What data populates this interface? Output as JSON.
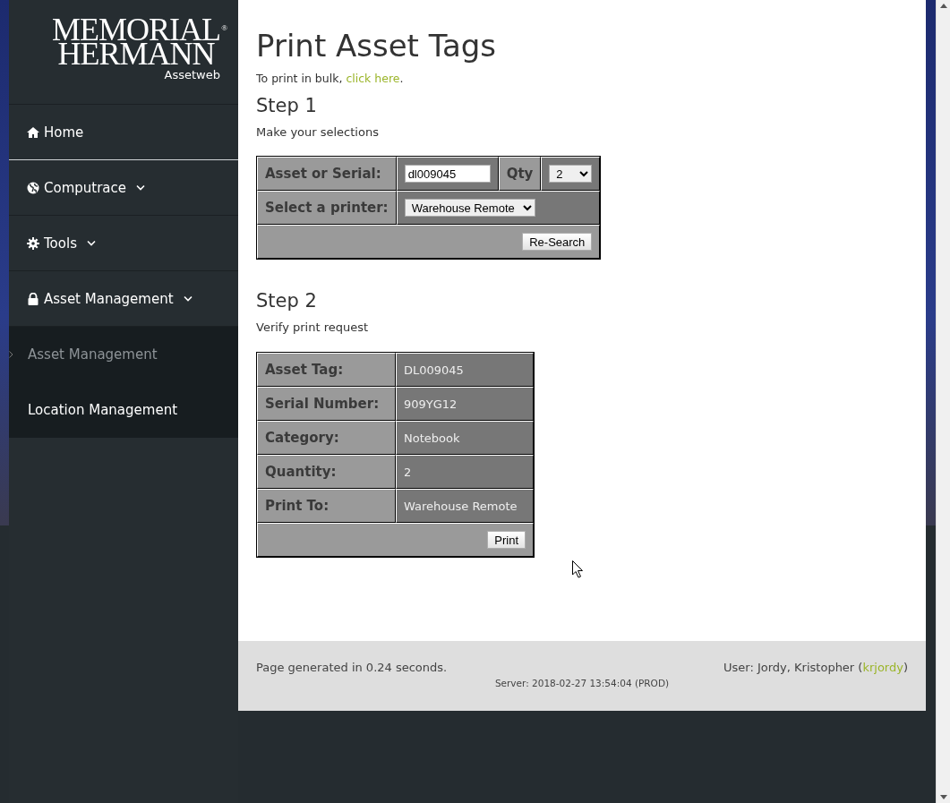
{
  "logo": {
    "line1": "MEMORIAL",
    "line2": "HERMANN",
    "registered": "®",
    "app": "Assetweb"
  },
  "nav": [
    {
      "label": "Home",
      "kind": "link",
      "selected": true
    },
    {
      "label": "Computrace",
      "kind": "dropdown",
      "selected": false
    },
    {
      "label": "Tools",
      "kind": "dropdown",
      "selected": false
    },
    {
      "label": "Asset Management",
      "kind": "dropdown",
      "selected": false,
      "children": [
        {
          "label": "Asset Management",
          "selected": true
        },
        {
          "label": "Location Management",
          "selected": false
        }
      ]
    }
  ],
  "page": {
    "title": "Print Asset Tags",
    "intro": {
      "text": "To print in bulk, ",
      "link": "click here",
      "end": "."
    },
    "step1": {
      "heading": "Step 1",
      "subtitle": "Make your selections",
      "asset_label": "Asset or Serial:",
      "asset_value": "dl009045",
      "qty_label": "Qty",
      "qty_value": "2",
      "printer_label": "Select a printer:",
      "printer_value": "Warehouse Remote",
      "button": "Re-Search"
    },
    "step2": {
      "heading": "Step 2",
      "subtitle": "Verify print request",
      "rows": [
        {
          "label": "Asset Tag:",
          "value": "DL009045"
        },
        {
          "label": "Serial Number:",
          "value": "909YG12"
        },
        {
          "label": "Category:",
          "value": "Notebook"
        },
        {
          "label": "Quantity:",
          "value": "2"
        },
        {
          "label": "Print To:",
          "value": "Warehouse Remote"
        }
      ],
      "button": "Print"
    }
  },
  "footer": {
    "generated": "Page generated in 0.24 seconds.",
    "user_text": "User: Jordy, Kristopher (",
    "user_link": "krjordy",
    "user_end": ")",
    "server": "Server: 2018-02-27 13:54:04 (PROD)"
  }
}
